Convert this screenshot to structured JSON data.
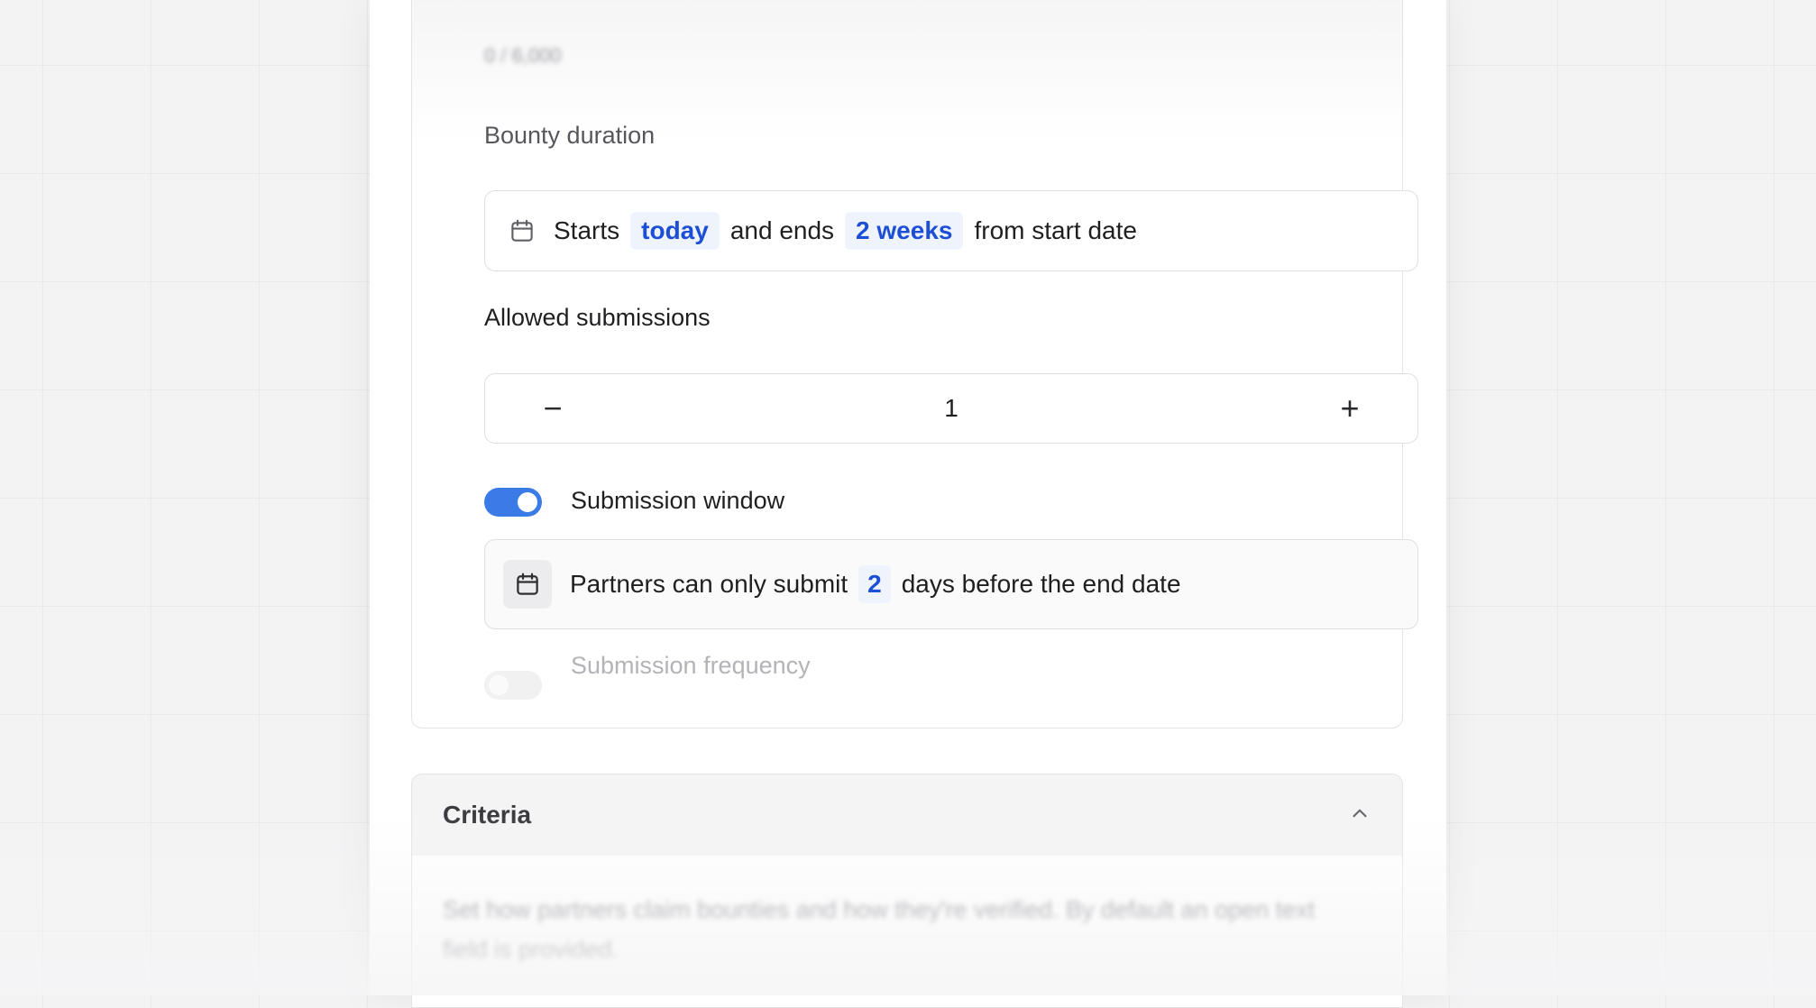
{
  "counter": "0 / 6,000",
  "bounty_duration": {
    "label": "Bounty duration",
    "starts_word": "Starts",
    "start_value": "today",
    "middle_text": "and ends",
    "end_value": "2 weeks",
    "suffix": "from start date",
    "icon": "calendar-icon"
  },
  "allowed_submissions": {
    "label": "Allowed submissions",
    "decrement": "−",
    "value": "1",
    "increment": "+"
  },
  "submission_window": {
    "label": "Submission window",
    "enabled": true,
    "prefix": "Partners can only submit",
    "days_value": "2",
    "suffix": "days before the end date",
    "icon": "calendar-icon"
  },
  "submission_frequency": {
    "label": "Submission frequency",
    "enabled": false
  },
  "criteria": {
    "title": "Criteria",
    "icon": "chevron-up-icon",
    "description": "Set how partners claim bounties and how they're verified. By default an open text field is provided."
  },
  "colors": {
    "accent": "#3b7be8",
    "pill_bg": "#eef3fc",
    "pill_text": "#1d4fd6"
  }
}
